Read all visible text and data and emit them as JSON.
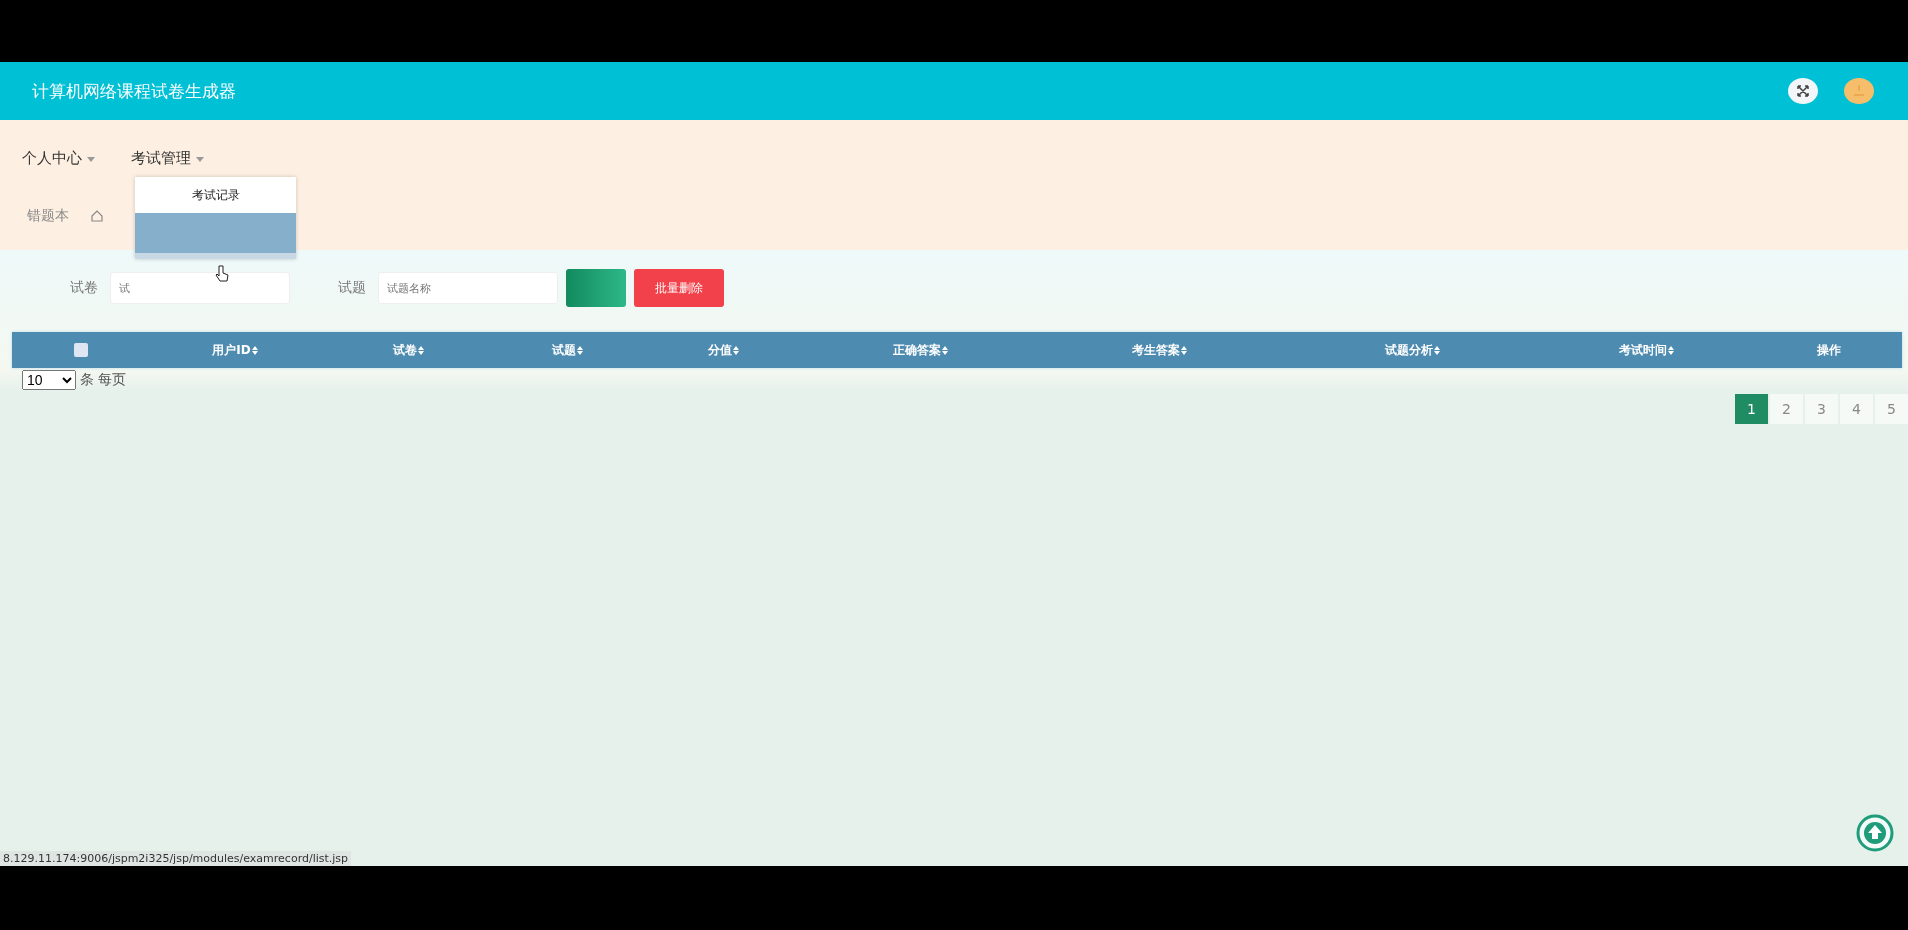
{
  "header": {
    "title": "计算机网络课程试卷生成器"
  },
  "nav": {
    "menus": [
      {
        "label": "个人中心"
      },
      {
        "label": "考试管理",
        "dropdown": [
          {
            "label": "考试记录",
            "highlighted": false
          },
          {
            "highlighted": true
          }
        ]
      }
    ],
    "second_row": [
      {
        "kind": "text",
        "label": "错题本"
      },
      {
        "kind": "icon"
      }
    ]
  },
  "search": {
    "fields": [
      {
        "label": "试卷",
        "placeholder": "试"
      },
      {
        "label": "试题",
        "placeholder": "试题名称"
      }
    ],
    "buttons": [
      {
        "kind": "search"
      },
      {
        "kind": "delete",
        "label": "批量删除"
      }
    ]
  },
  "table": {
    "columns": [
      {
        "kind": "checkbox",
        "checked": false
      },
      {
        "kind": "sortable",
        "label": "用户ID"
      },
      {
        "kind": "sortable",
        "label": "试卷"
      },
      {
        "kind": "sortable",
        "label": "试题"
      },
      {
        "kind": "sortable",
        "label": "分值"
      },
      {
        "kind": "sortable",
        "label": "正确答案"
      },
      {
        "kind": "sortable",
        "label": "考生答案"
      },
      {
        "kind": "sortable",
        "label": "试题分析"
      },
      {
        "kind": "sortable",
        "label": "考试时间"
      },
      {
        "kind": "plain",
        "label": "操作"
      }
    ]
  },
  "page_size": {
    "value": "10",
    "unit": "条 每页"
  },
  "pagination": [
    {
      "label": "1",
      "selected": true
    },
    {
      "label": "2",
      "selected": false
    },
    {
      "label": "3",
      "selected": false
    },
    {
      "label": "4",
      "selected": false
    },
    {
      "label": "5",
      "selected": false
    }
  ],
  "status_url": "8.129.11.174:9006/jspm2i325/jsp/modules/examrecord/list.jsp"
}
